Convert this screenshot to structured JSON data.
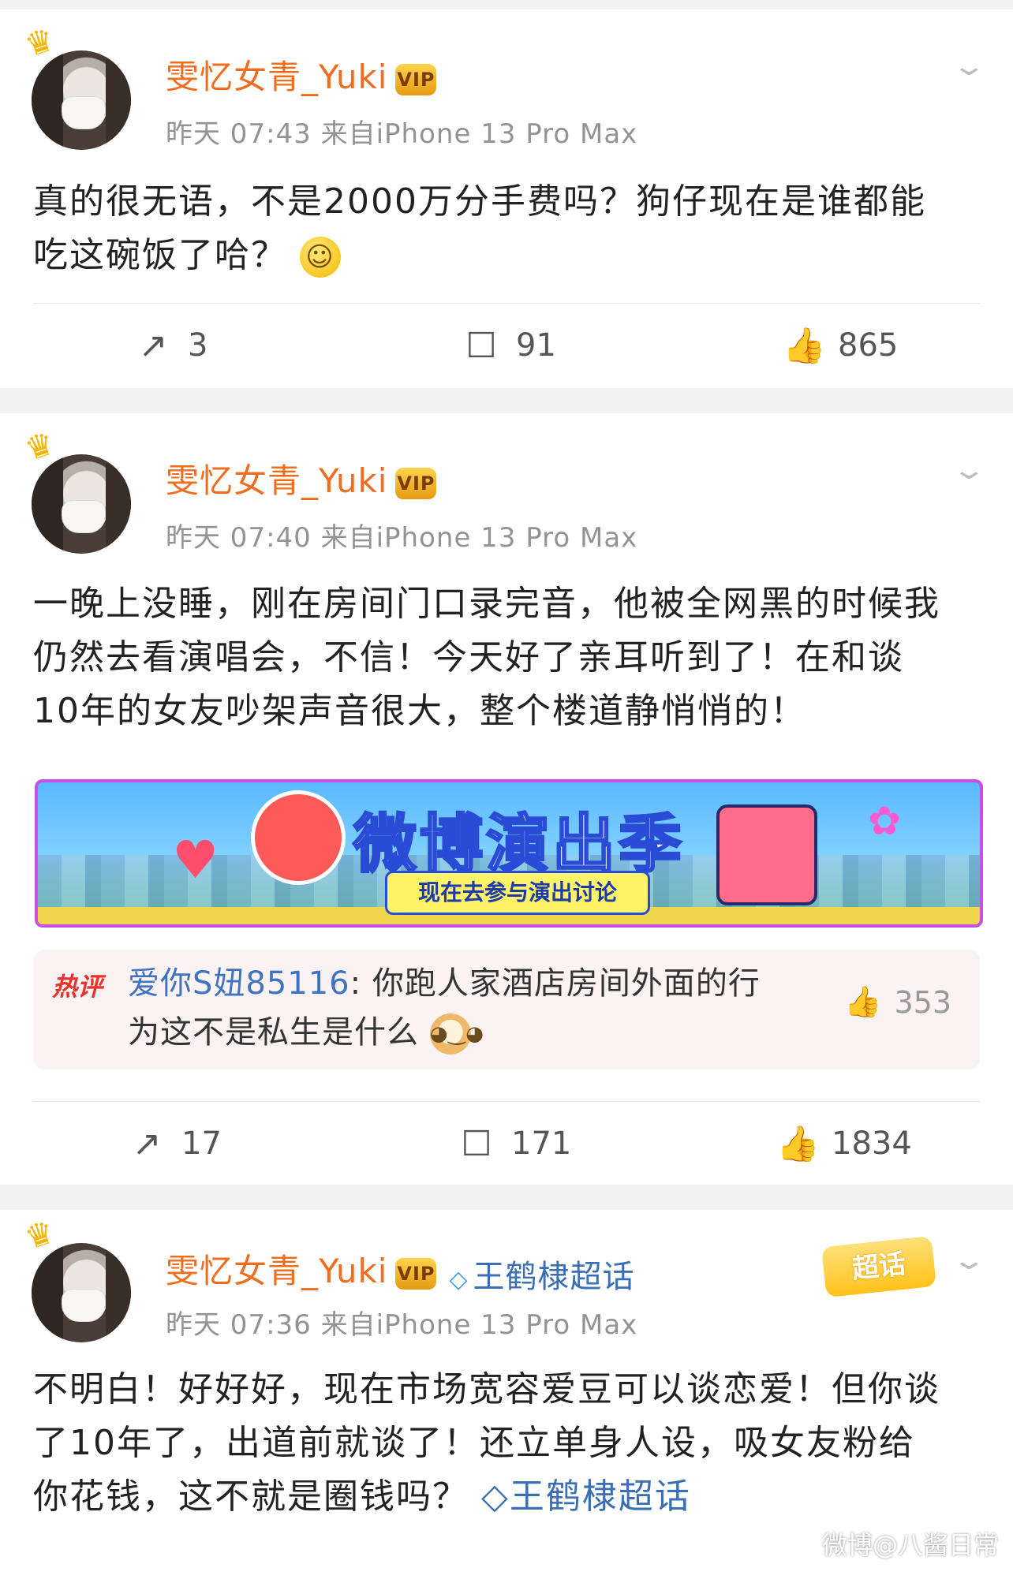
{
  "posts": [
    {
      "username": "雯忆女青_Yuki",
      "meta": "昨天 07:43  来自iPhone 13 Pro Max",
      "lines": [
        "真的很无语，不是2000万分手费吗？狗仔现在是谁都能",
        "吃这碗饭了哈？"
      ],
      "repost": "3",
      "comments": "91",
      "likes": "865"
    },
    {
      "username": "雯忆女青_Yuki",
      "meta": "昨天 07:40  来自iPhone 13 Pro Max",
      "lines": [
        "一晚上没睡，刚在房间门口录完音，他被全网黑的时候我",
        "仍然去看演唱会，不信！今天好了亲耳听到了！在和谈",
        "10年的女友吵架声音很大，整个楼道静悄悄的！"
      ],
      "banner": {
        "title": "微博演出季",
        "cta": "现在去参与演出讨论"
      },
      "hot_comment": {
        "tag": "热评",
        "user": "爱你S妞85116",
        "line1": ": 你跑人家酒店房间外面的行",
        "line2": "为这不是私生是什么",
        "likes": "353"
      },
      "repost": "17",
      "comments": "171",
      "likes": "1834"
    },
    {
      "username": "雯忆女青_Yuki",
      "topic": "王鹤棣超话",
      "superchat_label": "超话",
      "meta": "昨天 07:36  来自iPhone 13 Pro Max",
      "lines": [
        "不明白！好好好，现在市场宽容爱豆可以谈恋爱！但你谈",
        "了10年了，出道前就谈了！还立单身人设，吸女友粉给",
        "你花钱，这不就是圈钱吗？"
      ],
      "inline_topic": "王鹤棣超话"
    }
  ],
  "vip_badge": "VIP",
  "watermark": "微博@八酱日常",
  "colors": {
    "username": "#ee6d1f",
    "topic": "#3a6fb5",
    "hot_tag": "#e8322b"
  }
}
